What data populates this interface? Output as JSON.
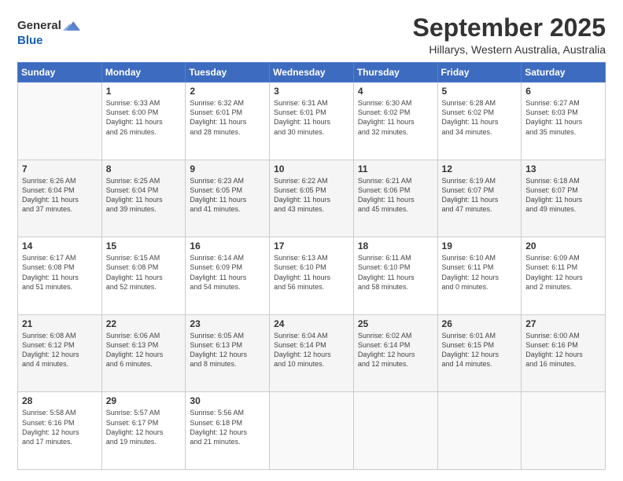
{
  "logo": {
    "line1": "General",
    "line2": "Blue"
  },
  "title": "September 2025",
  "subtitle": "Hillarys, Western Australia, Australia",
  "days_header": [
    "Sunday",
    "Monday",
    "Tuesday",
    "Wednesday",
    "Thursday",
    "Friday",
    "Saturday"
  ],
  "weeks": [
    [
      {
        "day": "",
        "info": ""
      },
      {
        "day": "1",
        "info": "Sunrise: 6:33 AM\nSunset: 6:00 PM\nDaylight: 11 hours\nand 26 minutes."
      },
      {
        "day": "2",
        "info": "Sunrise: 6:32 AM\nSunset: 6:01 PM\nDaylight: 11 hours\nand 28 minutes."
      },
      {
        "day": "3",
        "info": "Sunrise: 6:31 AM\nSunset: 6:01 PM\nDaylight: 11 hours\nand 30 minutes."
      },
      {
        "day": "4",
        "info": "Sunrise: 6:30 AM\nSunset: 6:02 PM\nDaylight: 11 hours\nand 32 minutes."
      },
      {
        "day": "5",
        "info": "Sunrise: 6:28 AM\nSunset: 6:02 PM\nDaylight: 11 hours\nand 34 minutes."
      },
      {
        "day": "6",
        "info": "Sunrise: 6:27 AM\nSunset: 6:03 PM\nDaylight: 11 hours\nand 35 minutes."
      }
    ],
    [
      {
        "day": "7",
        "info": "Sunrise: 6:26 AM\nSunset: 6:04 PM\nDaylight: 11 hours\nand 37 minutes."
      },
      {
        "day": "8",
        "info": "Sunrise: 6:25 AM\nSunset: 6:04 PM\nDaylight: 11 hours\nand 39 minutes."
      },
      {
        "day": "9",
        "info": "Sunrise: 6:23 AM\nSunset: 6:05 PM\nDaylight: 11 hours\nand 41 minutes."
      },
      {
        "day": "10",
        "info": "Sunrise: 6:22 AM\nSunset: 6:05 PM\nDaylight: 11 hours\nand 43 minutes."
      },
      {
        "day": "11",
        "info": "Sunrise: 6:21 AM\nSunset: 6:06 PM\nDaylight: 11 hours\nand 45 minutes."
      },
      {
        "day": "12",
        "info": "Sunrise: 6:19 AM\nSunset: 6:07 PM\nDaylight: 11 hours\nand 47 minutes."
      },
      {
        "day": "13",
        "info": "Sunrise: 6:18 AM\nSunset: 6:07 PM\nDaylight: 11 hours\nand 49 minutes."
      }
    ],
    [
      {
        "day": "14",
        "info": "Sunrise: 6:17 AM\nSunset: 6:08 PM\nDaylight: 11 hours\nand 51 minutes."
      },
      {
        "day": "15",
        "info": "Sunrise: 6:15 AM\nSunset: 6:08 PM\nDaylight: 11 hours\nand 52 minutes."
      },
      {
        "day": "16",
        "info": "Sunrise: 6:14 AM\nSunset: 6:09 PM\nDaylight: 11 hours\nand 54 minutes."
      },
      {
        "day": "17",
        "info": "Sunrise: 6:13 AM\nSunset: 6:10 PM\nDaylight: 11 hours\nand 56 minutes."
      },
      {
        "day": "18",
        "info": "Sunrise: 6:11 AM\nSunset: 6:10 PM\nDaylight: 11 hours\nand 58 minutes."
      },
      {
        "day": "19",
        "info": "Sunrise: 6:10 AM\nSunset: 6:11 PM\nDaylight: 12 hours\nand 0 minutes."
      },
      {
        "day": "20",
        "info": "Sunrise: 6:09 AM\nSunset: 6:11 PM\nDaylight: 12 hours\nand 2 minutes."
      }
    ],
    [
      {
        "day": "21",
        "info": "Sunrise: 6:08 AM\nSunset: 6:12 PM\nDaylight: 12 hours\nand 4 minutes."
      },
      {
        "day": "22",
        "info": "Sunrise: 6:06 AM\nSunset: 6:13 PM\nDaylight: 12 hours\nand 6 minutes."
      },
      {
        "day": "23",
        "info": "Sunrise: 6:05 AM\nSunset: 6:13 PM\nDaylight: 12 hours\nand 8 minutes."
      },
      {
        "day": "24",
        "info": "Sunrise: 6:04 AM\nSunset: 6:14 PM\nDaylight: 12 hours\nand 10 minutes."
      },
      {
        "day": "25",
        "info": "Sunrise: 6:02 AM\nSunset: 6:14 PM\nDaylight: 12 hours\nand 12 minutes."
      },
      {
        "day": "26",
        "info": "Sunrise: 6:01 AM\nSunset: 6:15 PM\nDaylight: 12 hours\nand 14 minutes."
      },
      {
        "day": "27",
        "info": "Sunrise: 6:00 AM\nSunset: 6:16 PM\nDaylight: 12 hours\nand 16 minutes."
      }
    ],
    [
      {
        "day": "28",
        "info": "Sunrise: 5:58 AM\nSunset: 6:16 PM\nDaylight: 12 hours\nand 17 minutes."
      },
      {
        "day": "29",
        "info": "Sunrise: 5:57 AM\nSunset: 6:17 PM\nDaylight: 12 hours\nand 19 minutes."
      },
      {
        "day": "30",
        "info": "Sunrise: 5:56 AM\nSunset: 6:18 PM\nDaylight: 12 hours\nand 21 minutes."
      },
      {
        "day": "",
        "info": ""
      },
      {
        "day": "",
        "info": ""
      },
      {
        "day": "",
        "info": ""
      },
      {
        "day": "",
        "info": ""
      }
    ]
  ]
}
